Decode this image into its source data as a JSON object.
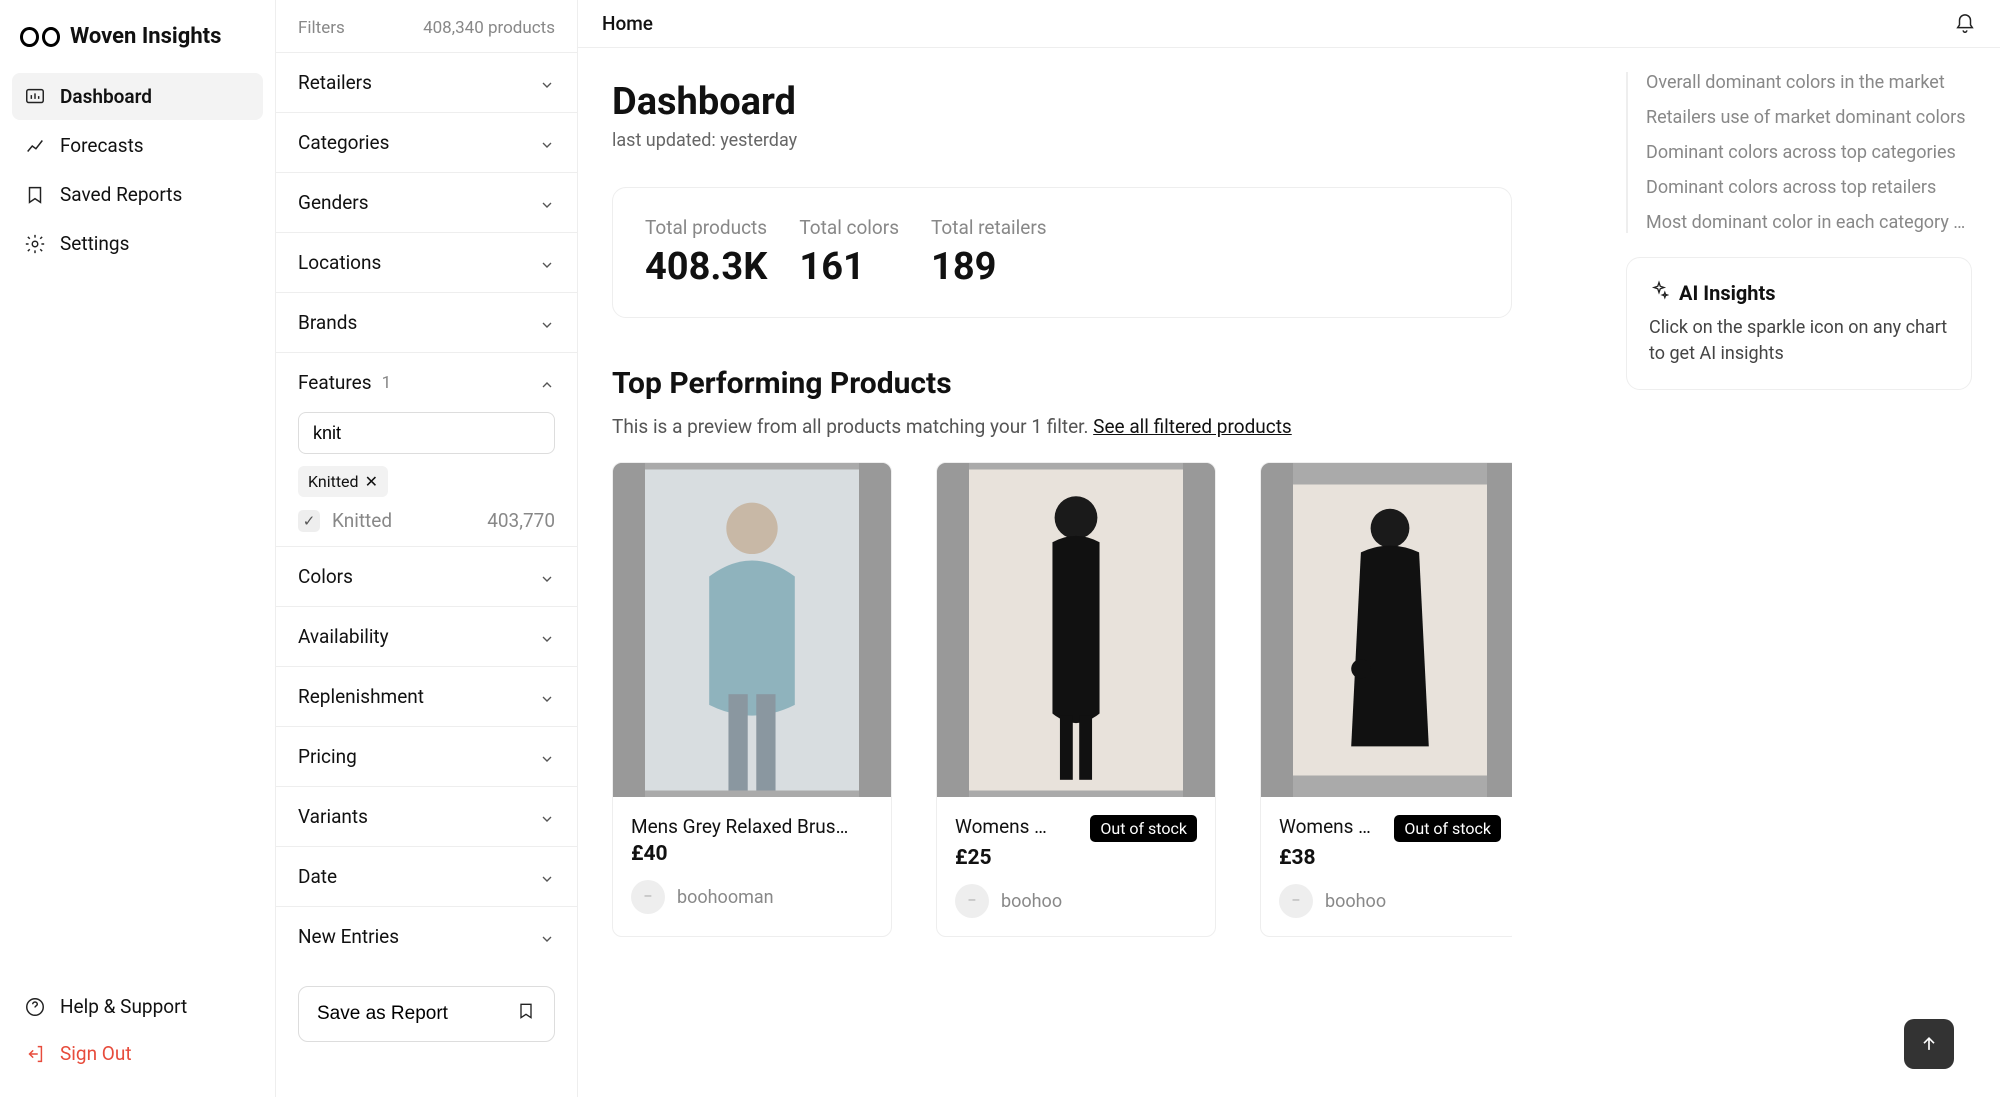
{
  "brand": "Woven Insights",
  "nav": {
    "items": [
      {
        "label": "Dashboard",
        "active": true
      },
      {
        "label": "Forecasts"
      },
      {
        "label": "Saved Reports"
      },
      {
        "label": "Settings"
      }
    ],
    "help": "Help & Support",
    "signout": "Sign Out"
  },
  "topbar": {
    "title": "Home"
  },
  "filters": {
    "title": "Filters",
    "total_count": "408,340 products",
    "groups": [
      {
        "label": "Retailers"
      },
      {
        "label": "Categories"
      },
      {
        "label": "Genders"
      },
      {
        "label": "Locations"
      },
      {
        "label": "Brands"
      }
    ],
    "features": {
      "label": "Features",
      "active_count": "1",
      "search_value": "knit",
      "chip": "Knitted",
      "option_label": "Knitted",
      "option_count": "403,770"
    },
    "groups2": [
      {
        "label": "Colors"
      },
      {
        "label": "Availability"
      },
      {
        "label": "Replenishment"
      },
      {
        "label": "Pricing"
      },
      {
        "label": "Variants"
      },
      {
        "label": "Date"
      },
      {
        "label": "New Entries"
      }
    ],
    "save_report": "Save as Report"
  },
  "main": {
    "title": "Dashboard",
    "subtitle": "last updated: yesterday",
    "stats": [
      {
        "label": "Total products",
        "value": "408.3K"
      },
      {
        "label": "Total colors",
        "value": "161"
      },
      {
        "label": "Total retailers",
        "value": "189"
      }
    ],
    "section_title": "Top Performing Products",
    "section_desc": "This is a preview from all products matching your 1 filter. ",
    "section_link": "See all filtered products",
    "products": [
      {
        "title": "Mens Grey Relaxed Brus…",
        "price": "£40",
        "retailer": "boohooman",
        "out_of_stock": false
      },
      {
        "title": "Womens …",
        "price": "£25",
        "retailer": "boohoo",
        "out_of_stock": true,
        "badge": "Out of stock"
      },
      {
        "title": "Womens …",
        "price": "£38",
        "retailer": "boohoo",
        "out_of_stock": true,
        "badge": "Out of stock"
      }
    ]
  },
  "rightcol": {
    "toc": [
      "Overall dominant colors in the market",
      "Retailers use of market dominant colors",
      "Dominant colors across top categories",
      "Dominant colors across top retailers",
      "Most dominant color in each category …"
    ],
    "ai_title": "AI Insights",
    "ai_body": "Click on the sparkle icon on any chart to get AI insights"
  }
}
